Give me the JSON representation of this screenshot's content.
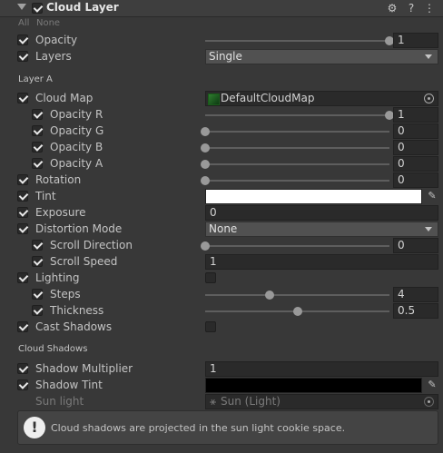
{
  "header": {
    "title": "Cloud Layer",
    "enabled": true,
    "icons": [
      "settings-icon",
      "help-icon",
      "more-icon"
    ],
    "icon_glyphs": {
      "settings": "⚙",
      "help": "?",
      "more": "⋮"
    }
  },
  "allnone": {
    "all": "All",
    "none": "None"
  },
  "rows": {
    "opacity": {
      "label": "Opacity",
      "value": "1",
      "checked": true,
      "slider": 1.0
    },
    "layers": {
      "label": "Layers",
      "value": "Single",
      "checked": true
    },
    "layer_a_title": "Layer A",
    "cloud_map": {
      "label": "Cloud Map",
      "value": "DefaultCloudMap",
      "checked": true
    },
    "opacity_r": {
      "label": "Opacity R",
      "value": "1",
      "checked": true,
      "slider": 1.0
    },
    "opacity_g": {
      "label": "Opacity G",
      "value": "0",
      "checked": true,
      "slider": 0.0
    },
    "opacity_b": {
      "label": "Opacity B",
      "value": "0",
      "checked": true,
      "slider": 0.0
    },
    "opacity_a": {
      "label": "Opacity A",
      "value": "0",
      "checked": true,
      "slider": 0.0
    },
    "rotation": {
      "label": "Rotation",
      "value": "0",
      "checked": true,
      "slider": 0.0
    },
    "tint": {
      "label": "Tint",
      "color": "#ffffff",
      "checked": true
    },
    "exposure": {
      "label": "Exposure",
      "value": "0",
      "checked": true
    },
    "distortion_mode": {
      "label": "Distortion Mode",
      "value": "None",
      "checked": true
    },
    "scroll_direction": {
      "label": "Scroll Direction",
      "value": "0",
      "checked": true,
      "slider": 0.0
    },
    "scroll_speed": {
      "label": "Scroll Speed",
      "value": "1",
      "checked": true
    },
    "lighting": {
      "label": "Lighting",
      "checked": true,
      "toggle": false
    },
    "steps": {
      "label": "Steps",
      "value": "4",
      "checked": true,
      "slider": 0.35
    },
    "thickness": {
      "label": "Thickness",
      "value": "0.5",
      "checked": true,
      "slider": 0.5
    },
    "cast_shadows": {
      "label": "Cast Shadows",
      "checked": true,
      "toggle": false
    },
    "cloud_shadows_title": "Cloud Shadows",
    "shadow_multiplier": {
      "label": "Shadow Multiplier",
      "value": "1",
      "checked": true
    },
    "shadow_tint": {
      "label": "Shadow Tint",
      "color": "#000000",
      "checked": true
    },
    "sun_light": {
      "label": "Sun light",
      "value": "Sun (Light)"
    }
  },
  "help": {
    "message": "Cloud shadows are projected in the sun light cookie space."
  }
}
